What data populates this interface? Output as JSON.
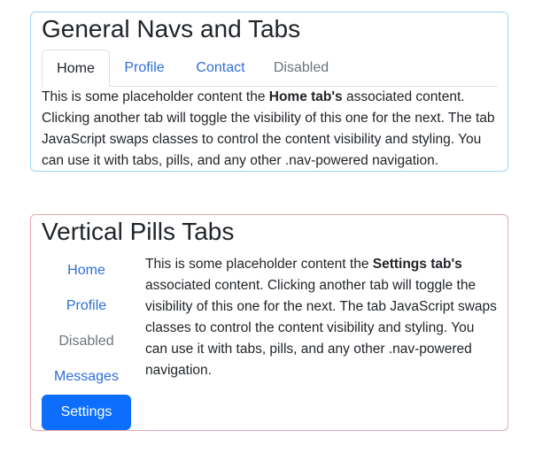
{
  "general": {
    "title": "General Navs and Tabs",
    "tabs": [
      {
        "label": "Home",
        "state": "active"
      },
      {
        "label": "Profile",
        "state": "link"
      },
      {
        "label": "Contact",
        "state": "link"
      },
      {
        "label": "Disabled",
        "state": "disabled"
      }
    ],
    "content": {
      "prefix": "This is some placeholder content the ",
      "bold": "Home tab's",
      "suffix": " associated content. Clicking another tab will toggle the visibility of this one for the next. The tab JavaScript swaps classes to control the content visibility and styling. You can use it with tabs, pills, and any other .nav-powered navigation."
    }
  },
  "vertical": {
    "title": "Vertical Pills Tabs",
    "pills": [
      {
        "label": "Home",
        "state": "link"
      },
      {
        "label": "Profile",
        "state": "link"
      },
      {
        "label": "Disabled",
        "state": "disabled"
      },
      {
        "label": "Messages",
        "state": "link"
      },
      {
        "label": "Settings",
        "state": "active"
      }
    ],
    "content": {
      "prefix": "This is some placeholder content the ",
      "bold": "Settings tab's",
      "suffix": " associated content. Clicking another tab will toggle the visibility of this one for the next. The tab JavaScript swaps classes to control the content visibility and styling. You can use it with tabs, pills, and any other .nav-powered navigation."
    }
  },
  "colors": {
    "link": "#2f6fd6",
    "active_pill_bg": "#0d6efd",
    "disabled": "#6c757d",
    "card1_border": "#9ed7f2",
    "card2_border": "#e8a6ae"
  }
}
